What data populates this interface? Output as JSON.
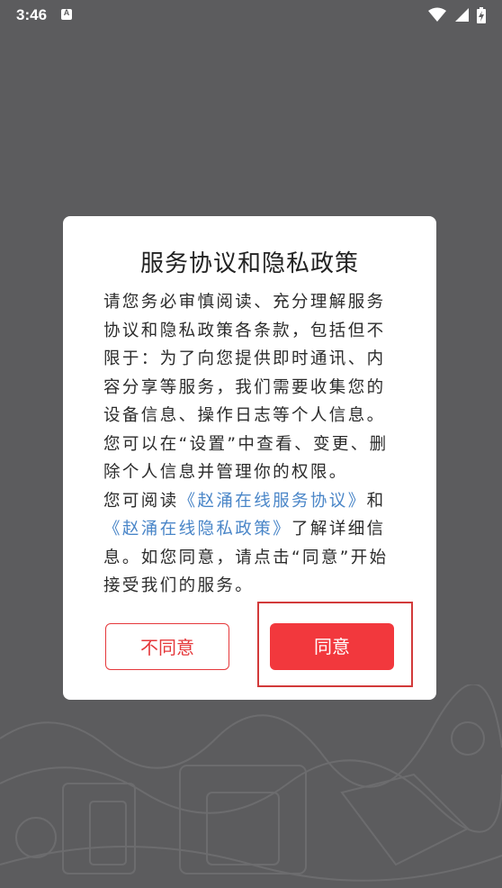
{
  "status_bar": {
    "time": "3:46",
    "notification_icon": "A",
    "icons": [
      "wifi-icon",
      "signal-icon",
      "battery-charging-icon"
    ]
  },
  "dialog": {
    "title": "服务协议和隐私政策",
    "paragraph1": "请您务必审慎阅读、充分理解服务协议和隐私政策各条款，包括但不限于：为了向您提供即时通讯、内容分享等服务，我们需要收集您的设备信息、操作日志等个人信息。您可以在“设置”中查看、变更、删除个人信息并管理你的权限。",
    "p2_prefix": "您可阅读",
    "service_link": "《赵涌在线服务协议》",
    "p2_and": "和",
    "privacy_link": "《赵涌在线隐私政策》",
    "p2_suffix": "了解详细信息。如您同意，请点击“同意”开始接受我们的服务。"
  },
  "buttons": {
    "disagree_label": "不同意",
    "agree_label": "同意"
  },
  "colors": {
    "accent": "#f2383d",
    "link": "#4a86c8",
    "overlay": "#5c5c5e"
  }
}
